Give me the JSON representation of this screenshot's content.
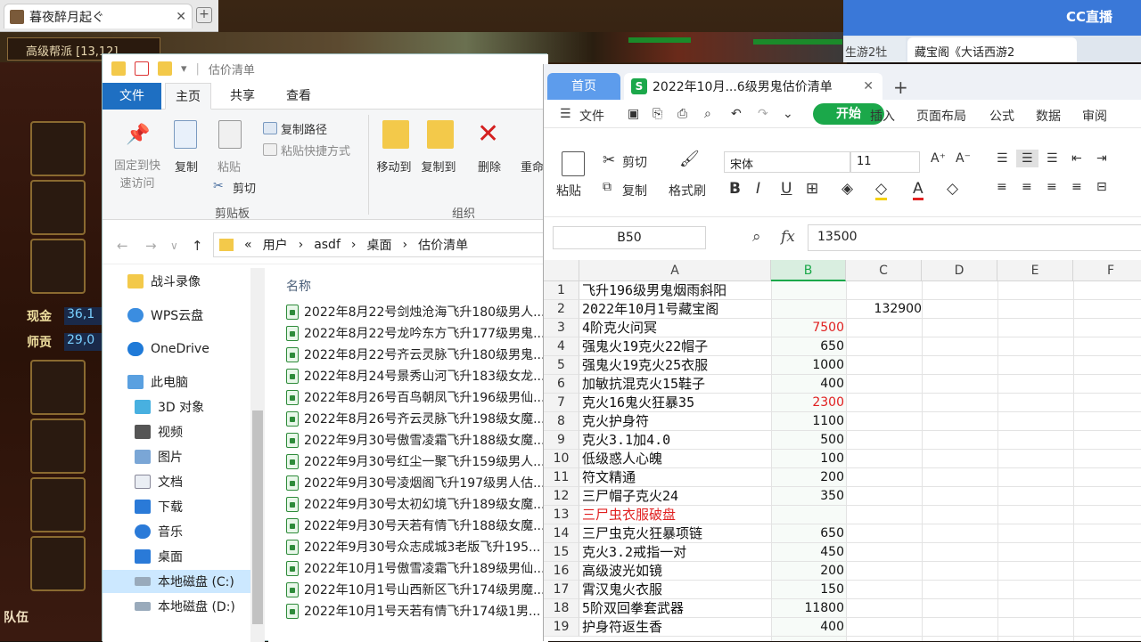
{
  "game": {
    "tab_title": "暮夜醉月起ぐ",
    "guild": "高级帮派 [13,12]",
    "stat1_label": "现金",
    "stat1_value": "36,1",
    "stat2_label": "师贡",
    "stat2_value": "29,0",
    "team_label": "队伍"
  },
  "browser2": {
    "tab1": "生游2牡",
    "tab2": "藏宝阁《大话西游2",
    "logo": "CC直播"
  },
  "explorer": {
    "title": "估价清单",
    "tabs": {
      "file": "文件",
      "home": "主页",
      "share": "共享",
      "view": "查看"
    },
    "ribbon": {
      "pin": "固定到快\n速访问",
      "copy": "复制",
      "paste": "粘贴",
      "cut": "剪切",
      "copy_path": "复制路径",
      "paste_shortcut": "粘贴快捷方式",
      "group_clipboard": "剪贴板",
      "move_to": "移动到",
      "copy_to": "复制到",
      "delete": "删除",
      "rename": "重命",
      "group_organize": "组织"
    },
    "breadcrumb": {
      "prefix": "«",
      "parts": [
        "用户",
        "asdf",
        "桌面",
        "估价清单"
      ]
    },
    "nav": [
      {
        "label": "战斗录像"
      },
      {
        "label": "WPS云盘"
      },
      {
        "label": "OneDrive"
      },
      {
        "label": "此电脑"
      },
      {
        "label": "3D 对象"
      },
      {
        "label": "视频"
      },
      {
        "label": "图片"
      },
      {
        "label": "文档"
      },
      {
        "label": "下载"
      },
      {
        "label": "音乐"
      },
      {
        "label": "桌面"
      },
      {
        "label": "本地磁盘 (C:)"
      },
      {
        "label": "本地磁盘 (D:)"
      }
    ],
    "column_name": "名称",
    "files": [
      "2022年8月22号剑烛沧海飞升180级男人...",
      "2022年8月22号龙吟东方飞升177级男鬼...",
      "2022年8月22号齐云灵脉飞升180级男鬼...",
      "2022年8月24号景秀山河飞升183级女龙...",
      "2022年8月26号百鸟朝凤飞升196级男仙...",
      "2022年8月26号齐云灵脉飞升198级女魔...",
      "2022年9月30号傲雪凌霜飞升188级女魔...",
      "2022年9月30号红尘一聚飞升159级男人...",
      "2022年9月30号凌烟阁飞升197级男人估...",
      "2022年9月30号太初幻境飞升189级女魔...",
      "2022年9月30号天若有情飞升188级女魔...",
      "2022年9月30号众志成城3老版飞升195...",
      "2022年10月1号傲雪凌霜飞升189级男仙...",
      "2022年10月1号山西新区飞升174级男魔...",
      "2022年10月1号天若有情飞升174级1男..."
    ]
  },
  "sheet": {
    "home_tab": "首页",
    "doc_tab": "2022年10月...6级男鬼估价清单",
    "menu": {
      "file": "文件",
      "start": "开始",
      "insert": "插入",
      "layout": "页面布局",
      "formula": "公式",
      "data": "数据",
      "review": "审阅"
    },
    "toolbar": {
      "cut": "剪切",
      "paste": "粘贴",
      "copy": "复制",
      "format_painter": "格式刷",
      "font": "宋体",
      "size": "11"
    },
    "name_box": "B50",
    "formula_value": "13500",
    "columns": [
      "A",
      "B",
      "C",
      "D",
      "E",
      "F"
    ],
    "rows": [
      {
        "n": "1",
        "a": "飞升196级男鬼烟雨斜阳",
        "b": "",
        "c": "",
        "a_red": false,
        "b_red": false
      },
      {
        "n": "2",
        "a": "2022年10月1号藏宝阁",
        "b": "",
        "c": "132900",
        "a_red": false,
        "b_red": false
      },
      {
        "n": "3",
        "a": "4阶克火问冥",
        "b": "7500",
        "c": "",
        "a_red": false,
        "b_red": true
      },
      {
        "n": "4",
        "a": "强鬼火19克火22帽子",
        "b": "650",
        "c": "",
        "a_red": false,
        "b_red": false
      },
      {
        "n": "5",
        "a": "强鬼火19克火25衣服",
        "b": "1000",
        "c": "",
        "a_red": false,
        "b_red": false
      },
      {
        "n": "6",
        "a": "加敏抗混克火15鞋子",
        "b": "400",
        "c": "",
        "a_red": false,
        "b_red": false
      },
      {
        "n": "7",
        "a": "克火16鬼火狂暴35",
        "b": "2300",
        "c": "",
        "a_red": false,
        "b_red": true
      },
      {
        "n": "8",
        "a": "克火护身符",
        "b": "1100",
        "c": "",
        "a_red": false,
        "b_red": false
      },
      {
        "n": "9",
        "a": "克火3.1加4.0",
        "b": "500",
        "c": "",
        "a_red": false,
        "b_red": false
      },
      {
        "n": "10",
        "a": "低级惑人心魄",
        "b": "100",
        "c": "",
        "a_red": false,
        "b_red": false
      },
      {
        "n": "11",
        "a": "符文精通",
        "b": "200",
        "c": "",
        "a_red": false,
        "b_red": false
      },
      {
        "n": "12",
        "a": "三尸帽子克火24",
        "b": "350",
        "c": "",
        "a_red": false,
        "b_red": false
      },
      {
        "n": "13",
        "a": "三尸虫衣服破盘",
        "b": "",
        "c": "",
        "a_red": true,
        "b_red": false
      },
      {
        "n": "14",
        "a": "三尸虫克火狂暴项链",
        "b": "650",
        "c": "",
        "a_red": false,
        "b_red": false
      },
      {
        "n": "15",
        "a": "克火3.2戒指一对",
        "b": "450",
        "c": "",
        "a_red": false,
        "b_red": false
      },
      {
        "n": "16",
        "a": "高级波光如镜",
        "b": "200",
        "c": "",
        "a_red": false,
        "b_red": false
      },
      {
        "n": "17",
        "a": "霄汉鬼火衣服",
        "b": "150",
        "c": "",
        "a_red": false,
        "b_red": false
      },
      {
        "n": "18",
        "a": "5阶双回拳套武器",
        "b": "11800",
        "c": "",
        "a_red": false,
        "b_red": false
      },
      {
        "n": "19",
        "a": "护身符返生香",
        "b": "400",
        "c": "",
        "a_red": false,
        "b_red": false
      }
    ]
  }
}
